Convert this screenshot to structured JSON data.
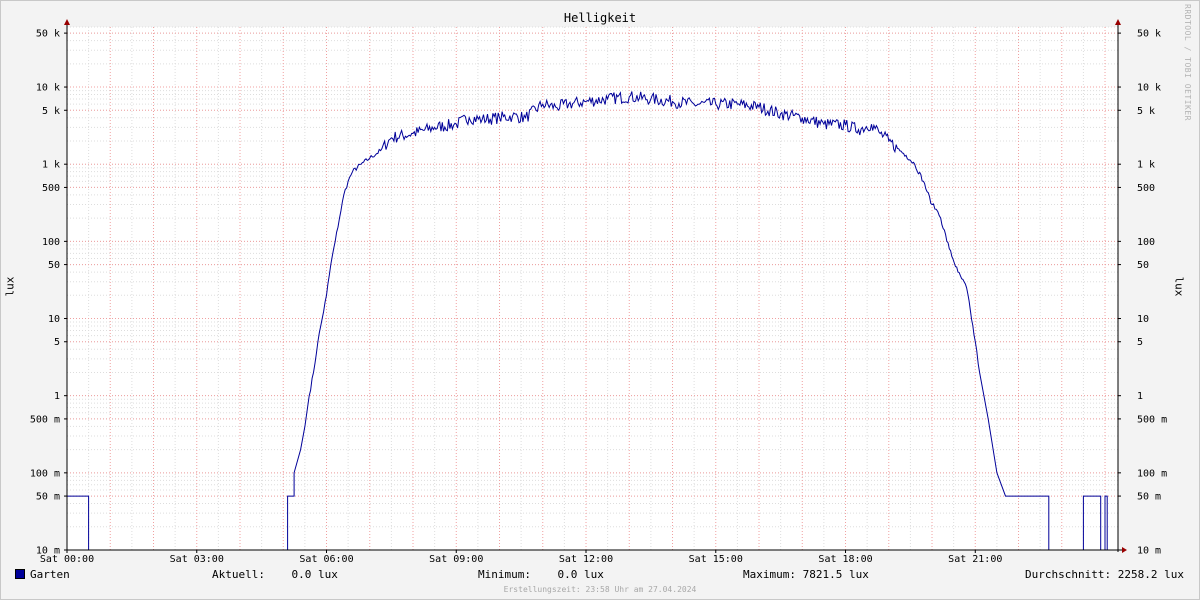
{
  "chart_data": {
    "type": "line",
    "title": "Helligkeit",
    "ylabel": "lux",
    "yscale": "log",
    "ylim": [
      0.01,
      60000
    ],
    "xlim": [
      0,
      24.3
    ],
    "grid": true,
    "x_ticks": [
      {
        "value": 0,
        "label": "Sat 00:00"
      },
      {
        "value": 3,
        "label": "Sat 03:00"
      },
      {
        "value": 6,
        "label": "Sat 06:00"
      },
      {
        "value": 9,
        "label": "Sat 09:00"
      },
      {
        "value": 12,
        "label": "Sat 12:00"
      },
      {
        "value": 15,
        "label": "Sat 15:00"
      },
      {
        "value": 18,
        "label": "Sat 18:00"
      },
      {
        "value": 21,
        "label": "Sat 21:00"
      }
    ],
    "y_ticks": [
      {
        "value": 0.01,
        "label": "10 m"
      },
      {
        "value": 0.05,
        "label": "50 m"
      },
      {
        "value": 0.1,
        "label": "100 m"
      },
      {
        "value": 0.5,
        "label": "500 m"
      },
      {
        "value": 1,
        "label": "1"
      },
      {
        "value": 5,
        "label": "5"
      },
      {
        "value": 10,
        "label": "10"
      },
      {
        "value": 50,
        "label": "50"
      },
      {
        "value": 100,
        "label": "100"
      },
      {
        "value": 500,
        "label": "500"
      },
      {
        "value": 1000,
        "label": "1 k"
      },
      {
        "value": 5000,
        "label": "5 k"
      },
      {
        "value": 10000,
        "label": "10 k"
      },
      {
        "value": 50000,
        "label": "50 k"
      }
    ],
    "series": [
      {
        "name": "Garten",
        "color": "#000099",
        "x": [
          0,
          0.5,
          0.5,
          5.1,
          5.1,
          5.25,
          5.25,
          5.4,
          5.5,
          5.6,
          5.7,
          5.8,
          5.9,
          6.0,
          6.1,
          6.2,
          6.3,
          6.4,
          6.5,
          6.6,
          6.8,
          7.0,
          7.25,
          7.5,
          8.0,
          8.5,
          9.0,
          9.3,
          9.6,
          10.0,
          10.3,
          10.6,
          11.0,
          11.3,
          11.6,
          12.0,
          12.5,
          13.0,
          13.5,
          14.0,
          14.5,
          15.0,
          15.5,
          16.0,
          16.5,
          17.0,
          17.5,
          18.0,
          18.3,
          18.6,
          18.8,
          19.0,
          19.2,
          19.4,
          19.6,
          19.8,
          20.0,
          20.1,
          20.2,
          20.4,
          20.6,
          20.8,
          21.0,
          21.1,
          21.3,
          21.5,
          21.7,
          21.85,
          22.0,
          22.7,
          22.7,
          23.5,
          23.5,
          23.9,
          23.9,
          24.0,
          24.0,
          24.05,
          24.05,
          24.2
        ],
        "y": [
          0.05,
          0.05,
          0.01,
          0.01,
          0.05,
          0.05,
          0.1,
          0.2,
          0.4,
          1,
          2,
          5,
          10,
          20,
          50,
          100,
          200,
          400,
          600,
          800,
          1000,
          1200,
          1500,
          2200,
          2500,
          3000,
          3300,
          4000,
          3800,
          4000,
          4200,
          4000,
          6000,
          5500,
          6000,
          6500,
          7000,
          7500,
          7000,
          6500,
          6000,
          6000,
          6000,
          5500,
          4500,
          4000,
          3300,
          3200,
          2800,
          3300,
          2500,
          2000,
          1600,
          1300,
          1000,
          600,
          300,
          260,
          200,
          80,
          40,
          25,
          5,
          2,
          0.5,
          0.1,
          0.05,
          0.05,
          0.05,
          0.05,
          0.01,
          0.01,
          0.05,
          0.05,
          0.01,
          0.01,
          0.05,
          0.05,
          0.01,
          0.01
        ]
      }
    ]
  },
  "legend": {
    "series_name": "Garten",
    "current": "Aktuell:    0.0 lux",
    "minimum": "Minimum:    0.0 lux",
    "maximum": "Maximum: 7821.5 lux",
    "average": "Durchschnitt: 2258.2 lux"
  },
  "credit": "RRDTOOL / TOBI OETIKER",
  "footer": "Erstellungszeit: 23:58 Uhr am 27.04.2024"
}
